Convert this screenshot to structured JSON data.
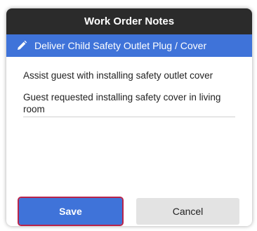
{
  "dialog": {
    "title": "Work Order Notes",
    "task": {
      "icon": "pencil-icon",
      "label": "Deliver Child Safety Outlet Plug / Cover"
    },
    "notes": [
      "Assist guest with installing safety outlet cover",
      "Guest requested installing safety cover in living room"
    ],
    "buttons": {
      "save_label": "Save",
      "cancel_label": "Cancel"
    }
  },
  "colors": {
    "title_bar": "#2b2b2b",
    "accent": "#3f73d9",
    "focus_outline": "#b8234a",
    "secondary_button": "#e3e3e3"
  }
}
